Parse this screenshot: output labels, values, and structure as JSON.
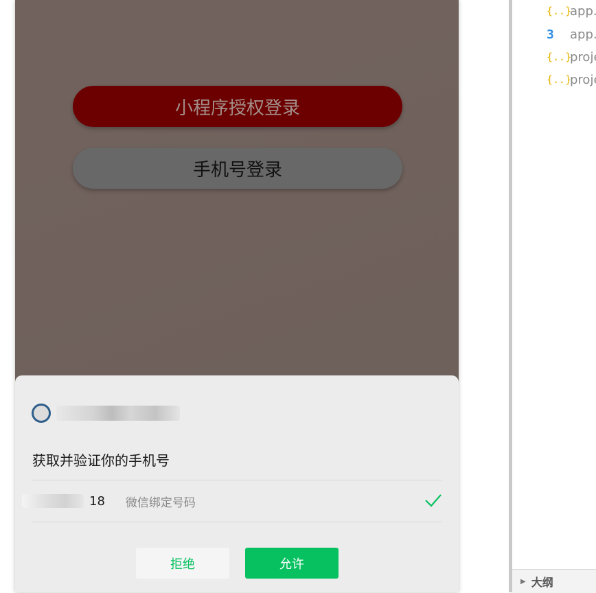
{
  "simulator": {
    "login_buttons": {
      "mini_program_auth": "小程序授权登录",
      "phone_login": "手机号登录"
    },
    "auth_sheet": {
      "title": "获取并验证你的手机号",
      "phone_suffix": "18",
      "phone_note": "微信绑定号码",
      "reject_label": "拒绝",
      "allow_label": "允许"
    }
  },
  "explorer": {
    "files": [
      {
        "icon": "json-icon",
        "glyph": "{..}",
        "name": "app.j"
      },
      {
        "icon": "css-icon",
        "glyph": "3",
        "name": "app."
      },
      {
        "icon": "json-icon",
        "glyph": "{..}",
        "name": "proje"
      },
      {
        "icon": "json-icon",
        "glyph": "{..}",
        "name": "proje"
      }
    ],
    "outline_label": "大纲"
  },
  "colors": {
    "primary_button": "#6c0000",
    "wechat_green": "#07c160",
    "overlay": "#6f625d"
  }
}
